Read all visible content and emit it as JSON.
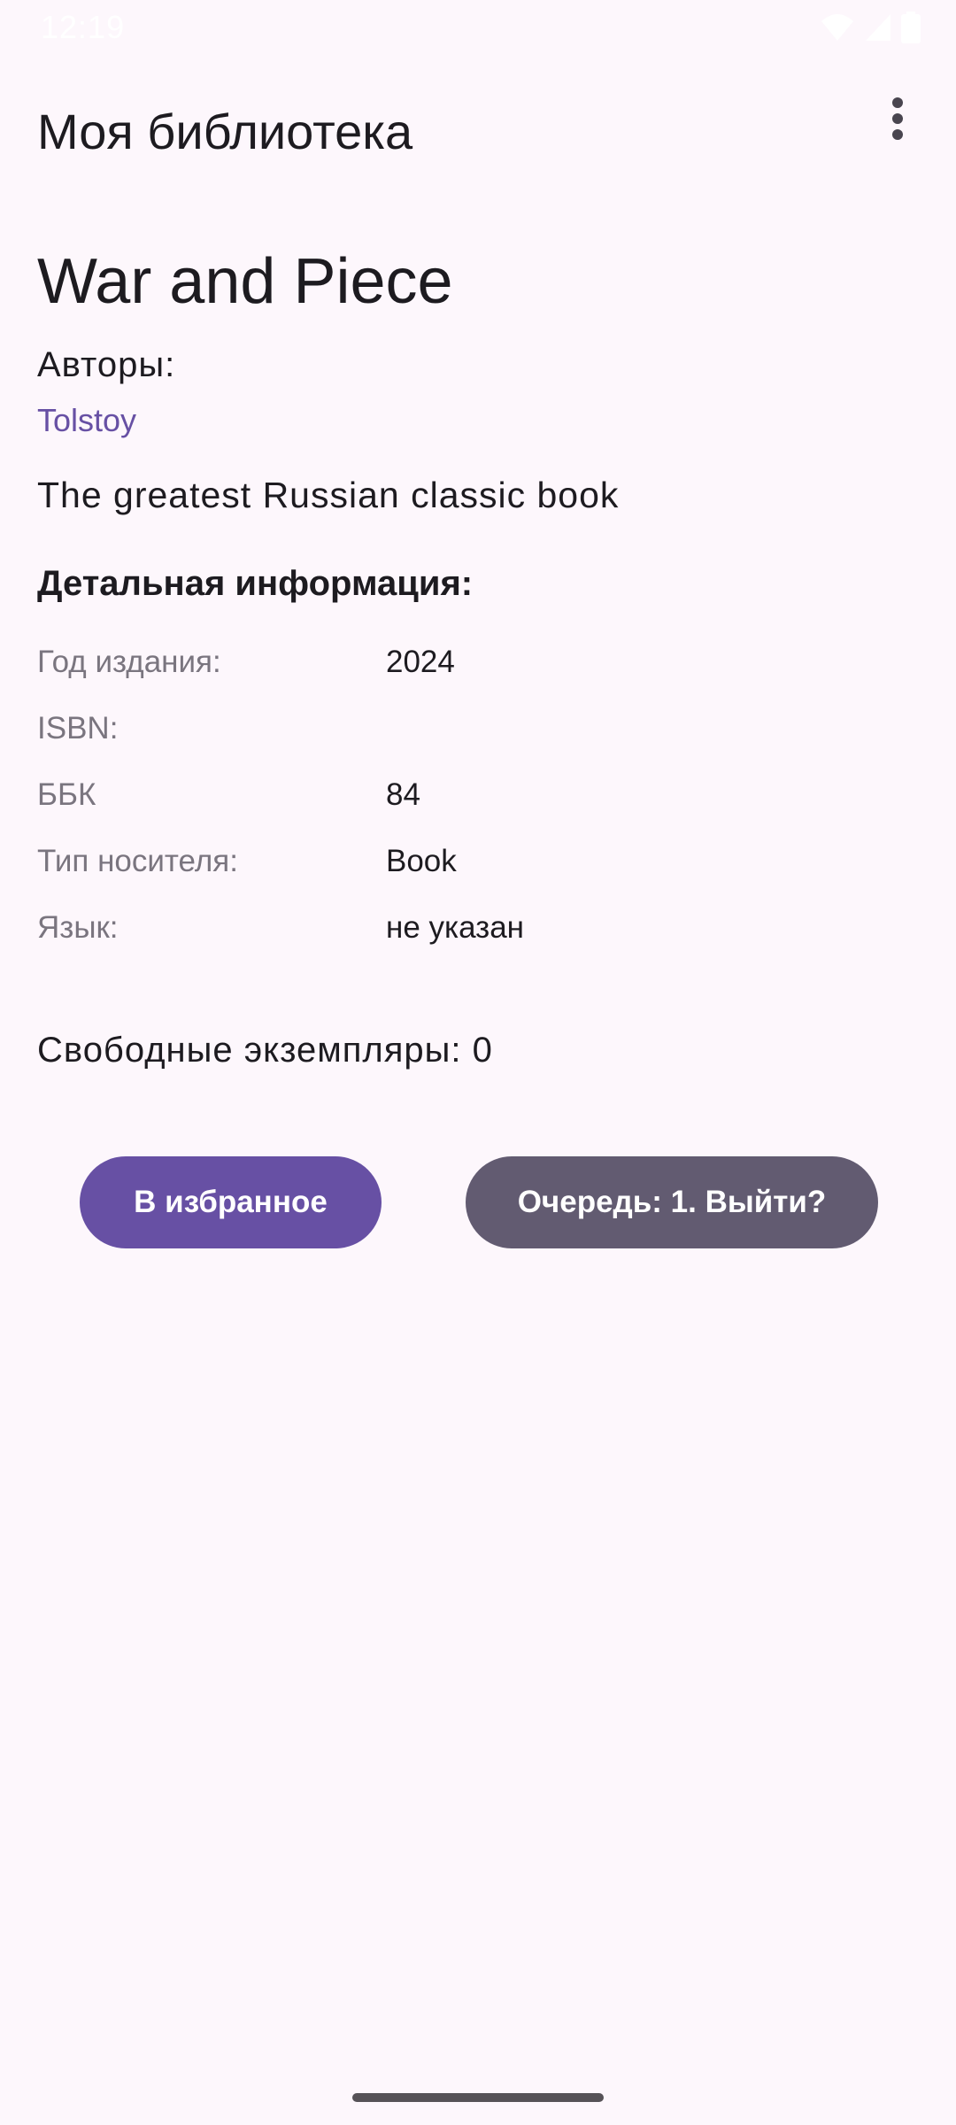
{
  "status_bar": {
    "time": "12:19",
    "icons": [
      "wifi-icon",
      "signal-icon",
      "battery-icon"
    ]
  },
  "app_bar": {
    "title": "Моя библиотека",
    "menu_icon": "more-vert-icon"
  },
  "book": {
    "title": "War and Piece",
    "authors_label": "Авторы:",
    "author": "Tolstoy",
    "description": "The greatest Russian classic book"
  },
  "details": {
    "heading": "Детальная информация:",
    "rows": [
      {
        "key": "Год издания:",
        "value": "2024"
      },
      {
        "key": "ISBN:",
        "value": ""
      },
      {
        "key": "ББК",
        "value": "84"
      },
      {
        "key": "Тип носителя:",
        "value": "Book"
      },
      {
        "key": "Язык:",
        "value": "не указан"
      }
    ]
  },
  "availability": {
    "free_copies": "Свободные экземпляры: 0"
  },
  "actions": {
    "favorite_label": "В избранное",
    "queue_label": "Очередь: 1. Выйти?"
  },
  "colors": {
    "background": "#fdf7fc",
    "primary": "#6750a4",
    "secondary": "#625b71",
    "muted_text": "#7a757f"
  }
}
